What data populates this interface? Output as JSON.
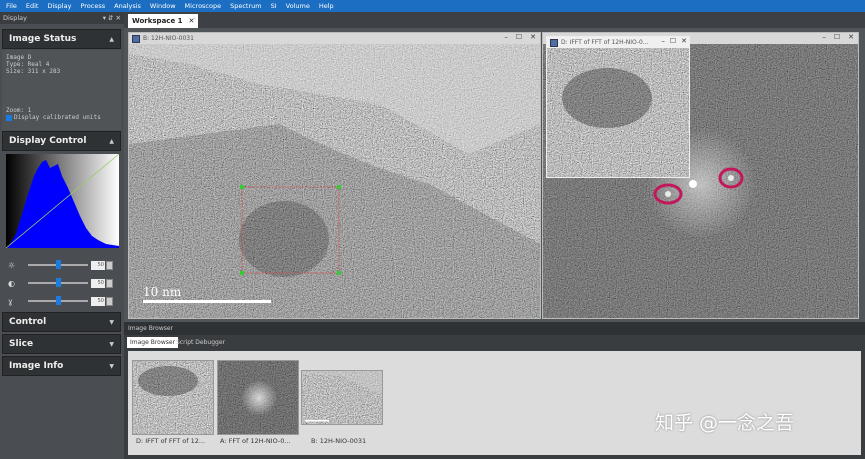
{
  "menu": [
    "File",
    "Edit",
    "Display",
    "Process",
    "Analysis",
    "Window",
    "Microscope",
    "Spectrum",
    "SI",
    "Volume",
    "Help"
  ],
  "left_panel": {
    "title": "Display",
    "title_controls": "▾ ⇵ ✕",
    "image_status": {
      "label": "Image Status",
      "lines": [
        "Image D",
        "Type: Real 4",
        "Size: 311 x 283"
      ],
      "zoom": "Zoom: 1",
      "checkbox_label": "Display calibrated units",
      "checked": true
    },
    "display_control": {
      "label": "Display Control",
      "sliders": [
        {
          "icon": "brightness-icon",
          "value": "50"
        },
        {
          "icon": "contrast-icon",
          "value": "50"
        },
        {
          "icon": "gamma-icon",
          "value": "50"
        }
      ]
    },
    "sections": [
      "Control",
      "Slice",
      "Image Info"
    ]
  },
  "workspace": {
    "tab_label": "Workspace 1",
    "close": "✕",
    "add": "+"
  },
  "windows": {
    "main": {
      "title": "B: 12H-NIO-0031",
      "scale_bar": "10 nm"
    },
    "ifft": {
      "title": "D: IFFT of FFT of 12H-NIO-0..."
    }
  },
  "browser": {
    "title": "Image Browser",
    "tabs": [
      "Image Browser",
      "Script Debugger"
    ],
    "thumbs": [
      "D: IFFT of FFT of 12...",
      "A: FFT of 12H-NIO-0...",
      "B: 12H-NIO-0031"
    ]
  },
  "watermark": "知乎 @一念之吾",
  "colors": {
    "menubar": "#1b6ec2",
    "highlight": "#c2185b",
    "roi": "#d05050",
    "histogram": "#0000ff"
  }
}
